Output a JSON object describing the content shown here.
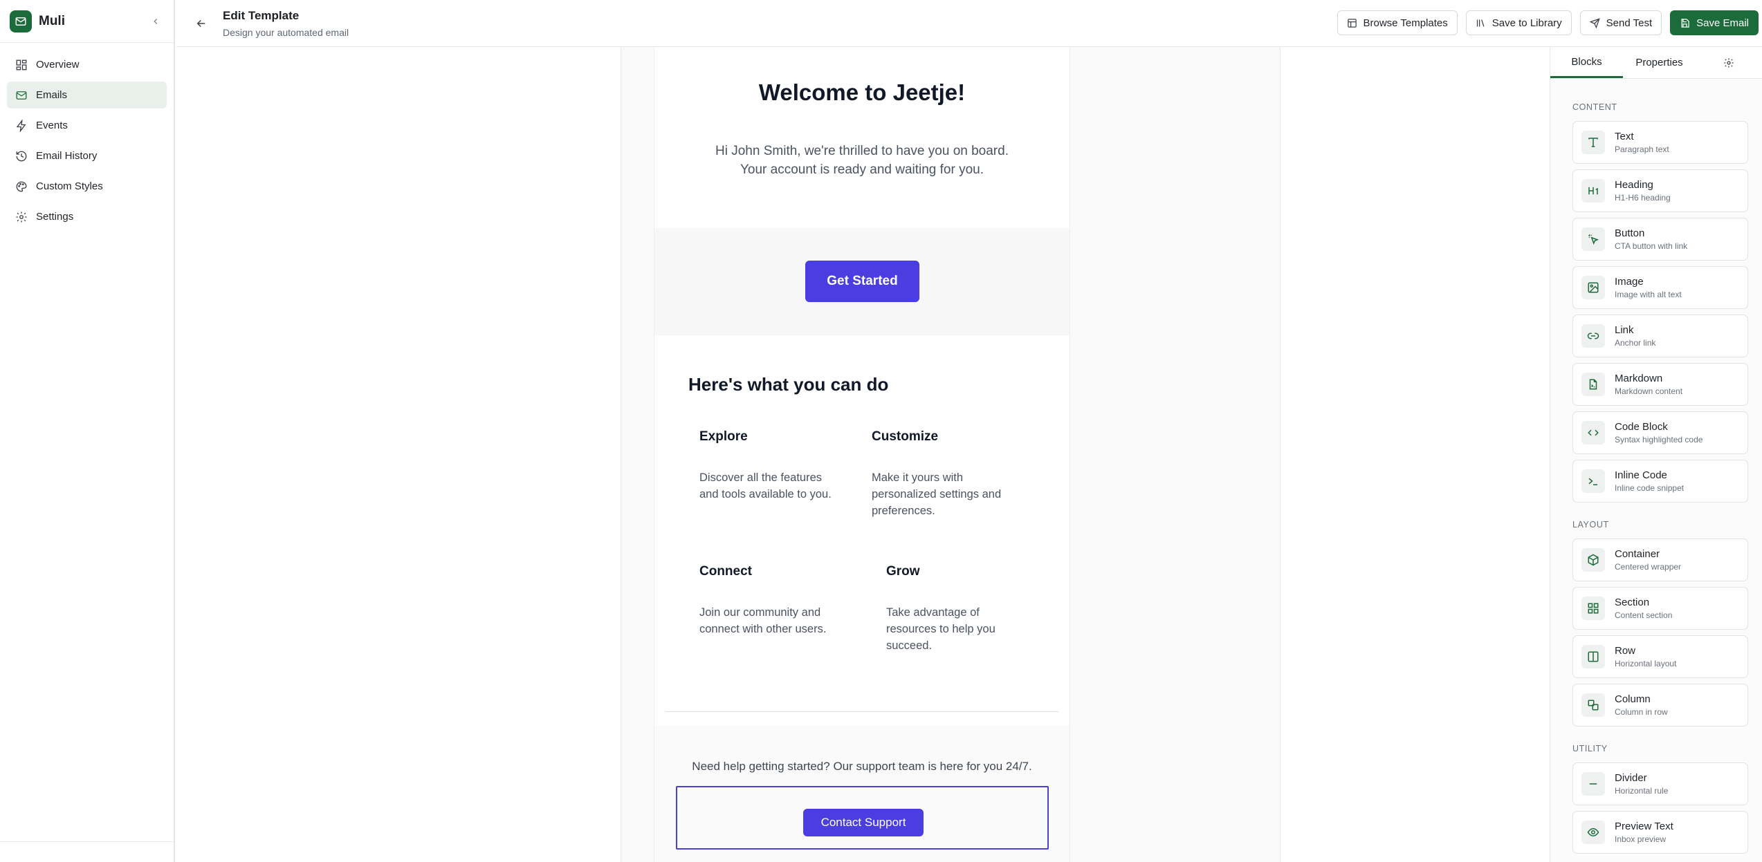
{
  "app": {
    "name": "Muli"
  },
  "sidebar": {
    "items": [
      {
        "label": "Overview",
        "icon": "dashboard-icon"
      },
      {
        "label": "Emails",
        "icon": "mail-icon",
        "active": true
      },
      {
        "label": "Events",
        "icon": "lightning-icon"
      },
      {
        "label": "Email History",
        "icon": "history-icon"
      },
      {
        "label": "Custom Styles",
        "icon": "palette-icon"
      },
      {
        "label": "Settings",
        "icon": "gear-icon"
      }
    ]
  },
  "header": {
    "title": "Edit Template",
    "subtitle": "Design your automated email",
    "actions": {
      "browse": "Browse Templates",
      "library": "Save to Library",
      "test": "Send Test",
      "save": "Save Email"
    }
  },
  "email": {
    "heading": "Welcome to Jeetje!",
    "intro_line1": "Hi John Smith, we're thrilled to have you on board.",
    "intro_line2": "Your account is ready and waiting for you.",
    "cta": "Get Started",
    "features_title": "Here's what you can do",
    "features": [
      {
        "title": "Explore",
        "text": "Discover all the features and tools available to you."
      },
      {
        "title": "Customize",
        "text": "Make it yours with personalized settings and preferences."
      },
      {
        "title": "Connect",
        "text": "Join our community and connect with other users."
      },
      {
        "title": "Grow",
        "text": "Take advantage of resources to help you succeed."
      }
    ],
    "footer_text": "Need help getting started? Our support team is here for you 24/7.",
    "contact_button": "Contact Support"
  },
  "panel": {
    "tabs": {
      "blocks": "Blocks",
      "properties": "Properties"
    },
    "groups": {
      "content": "CONTENT",
      "layout": "LAYOUT",
      "utility": "UTILITY"
    },
    "content_blocks": [
      {
        "name": "Text",
        "desc": "Paragraph text",
        "icon": "text-icon"
      },
      {
        "name": "Heading",
        "desc": "H1-H6 heading",
        "icon": "heading-icon"
      },
      {
        "name": "Button",
        "desc": "CTA button with link",
        "icon": "pointer-icon"
      },
      {
        "name": "Image",
        "desc": "Image with alt text",
        "icon": "image-icon"
      },
      {
        "name": "Link",
        "desc": "Anchor link",
        "icon": "link-icon"
      },
      {
        "name": "Markdown",
        "desc": "Markdown content",
        "icon": "file-icon"
      },
      {
        "name": "Code Block",
        "desc": "Syntax highlighted code",
        "icon": "code-icon"
      },
      {
        "name": "Inline Code",
        "desc": "Inline code snippet",
        "icon": "terminal-icon"
      }
    ],
    "layout_blocks": [
      {
        "name": "Container",
        "desc": "Centered wrapper",
        "icon": "box-icon"
      },
      {
        "name": "Section",
        "desc": "Content section",
        "icon": "grid-icon"
      },
      {
        "name": "Row",
        "desc": "Horizontal layout",
        "icon": "columns-icon"
      },
      {
        "name": "Column",
        "desc": "Column in row",
        "icon": "column-icon"
      }
    ],
    "utility_blocks": [
      {
        "name": "Divider",
        "desc": "Horizontal rule",
        "icon": "minus-icon"
      },
      {
        "name": "Preview Text",
        "desc": "Inbox preview",
        "icon": "eye-icon"
      }
    ]
  },
  "colors": {
    "brand": "#1c6b3a",
    "accent": "#4a3ee0"
  }
}
